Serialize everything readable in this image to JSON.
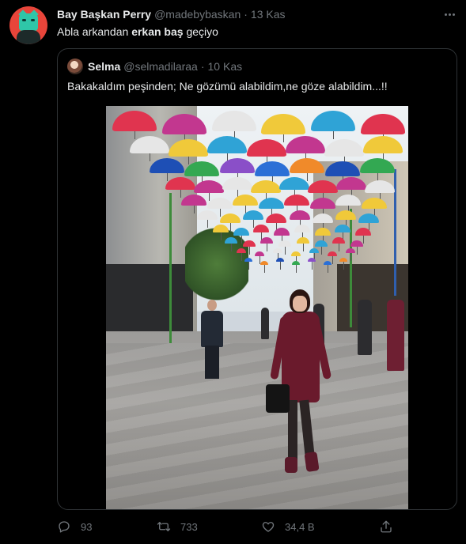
{
  "tweet": {
    "author_name": "Bay Başkan Perry",
    "author_handle": "@madebybaskan",
    "separator": "·",
    "date": "13 Kas",
    "text_before": "Abla arkandan ",
    "text_bold": "erkan baş",
    "text_after": " geçiyo"
  },
  "quote": {
    "author_name": "Selma",
    "author_handle": "@selmadilaraa",
    "separator": "·",
    "date": "10 Kas",
    "text": "Bakakaldım peşinden; Ne gözümü alabildim,ne göze alabildim...!!"
  },
  "actions": {
    "replies": "93",
    "retweets": "733",
    "likes": "34,4 B"
  },
  "icons": {
    "more": "more-icon",
    "reply": "reply-icon",
    "retweet": "retweet-icon",
    "like": "heart-icon",
    "share": "share-icon"
  },
  "colors": {
    "background": "#000000",
    "text": "#e7e9ea",
    "secondary": "#71767b",
    "border": "#2f3336"
  }
}
